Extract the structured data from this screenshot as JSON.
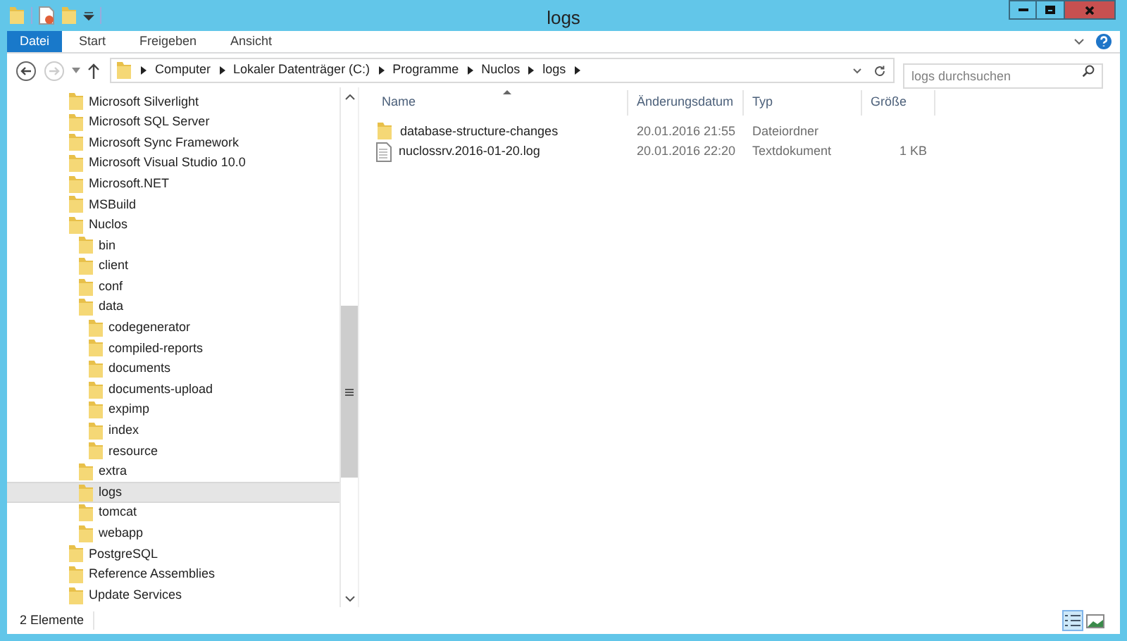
{
  "window": {
    "title": "logs"
  },
  "ribbon_tabs": [
    {
      "label": "Datei",
      "selected": true
    },
    {
      "label": "Start",
      "selected": false
    },
    {
      "label": "Freigeben",
      "selected": false
    },
    {
      "label": "Ansicht",
      "selected": false
    }
  ],
  "address_bar": {
    "segments": [
      "Computer",
      "Lokaler Datenträger (C:)",
      "Programme",
      "Nuclos",
      "logs"
    ]
  },
  "search": {
    "placeholder": "logs durchsuchen"
  },
  "tree": [
    {
      "label": "Microsoft Silverlight",
      "selected": false
    },
    {
      "label": "Microsoft SQL Server",
      "selected": false
    },
    {
      "label": "Microsoft Sync Framework",
      "selected": false
    },
    {
      "label": "Microsoft Visual Studio 10.0",
      "selected": false
    },
    {
      "label": "Microsoft.NET",
      "selected": false
    },
    {
      "label": "MSBuild",
      "selected": false
    },
    {
      "label": "Nuclos",
      "selected": false,
      "children": [
        {
          "label": "bin",
          "selected": false
        },
        {
          "label": "client",
          "selected": false
        },
        {
          "label": "conf",
          "selected": false
        },
        {
          "label": "data",
          "selected": false,
          "children": [
            {
              "label": "codegenerator",
              "selected": false
            },
            {
              "label": "compiled-reports",
              "selected": false
            },
            {
              "label": "documents",
              "selected": false
            },
            {
              "label": "documents-upload",
              "selected": false
            },
            {
              "label": "expimp",
              "selected": false
            },
            {
              "label": "index",
              "selected": false
            },
            {
              "label": "resource",
              "selected": false
            }
          ]
        },
        {
          "label": "extra",
          "selected": false
        },
        {
          "label": "logs",
          "selected": true
        },
        {
          "label": "tomcat",
          "selected": false
        },
        {
          "label": "webapp",
          "selected": false
        }
      ]
    },
    {
      "label": "PostgreSQL",
      "selected": false
    },
    {
      "label": "Reference Assemblies",
      "selected": false
    },
    {
      "label": "Update Services",
      "selected": false
    }
  ],
  "file_list": {
    "columns": [
      "Name",
      "Änderungsdatum",
      "Typ",
      "Größe"
    ],
    "rows": [
      {
        "kind": "folder",
        "name": "database-structure-changes",
        "date": "20.01.2016 21:55",
        "type": "Dateiordner"
      },
      {
        "kind": "file",
        "name": "nuclossrv.2016-01-20.log",
        "date": "20.01.2016 22:20",
        "type": "Textdokument",
        "size": "1 KB"
      }
    ]
  },
  "status_bar": {
    "count": "2 Elemente"
  }
}
